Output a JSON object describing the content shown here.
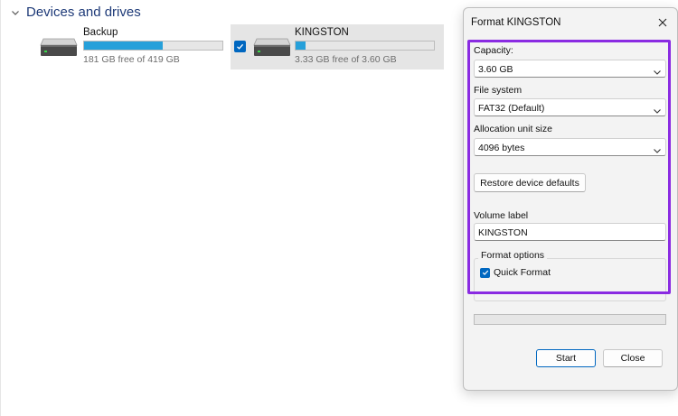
{
  "section": {
    "title": "Devices and drives",
    "expand_icon": "chevron-down-icon"
  },
  "drives": [
    {
      "name": "Backup",
      "free_text": "181 GB free of 419 GB",
      "used_fraction": 0.57,
      "selected": false,
      "icon": "hard-drive-icon"
    },
    {
      "name": "KINGSTON",
      "free_text": "3.33 GB free of 3.60 GB",
      "used_fraction": 0.075,
      "selected": true,
      "icon": "hard-drive-icon"
    }
  ],
  "dialog": {
    "title": "Format KINGSTON",
    "close_icon": "close-icon",
    "capacity": {
      "label": "Capacity:",
      "value": "3.60 GB"
    },
    "file_system": {
      "label": "File system",
      "value": "FAT32 (Default)"
    },
    "allocation": {
      "label": "Allocation unit size",
      "value": "4096 bytes"
    },
    "restore_button": "Restore device defaults",
    "volume_label": {
      "label": "Volume label",
      "value": "KINGSTON"
    },
    "format_options": {
      "title": "Format options",
      "quick_format_label": "Quick Format",
      "quick_format_checked": true
    },
    "progress_fraction": 0,
    "start_button": "Start",
    "close_button": "Close"
  },
  "colors": {
    "accent": "#0067c0",
    "usage_fill": "#26a0da",
    "highlight": "#8a2be2",
    "section_title": "#1e3a78"
  }
}
